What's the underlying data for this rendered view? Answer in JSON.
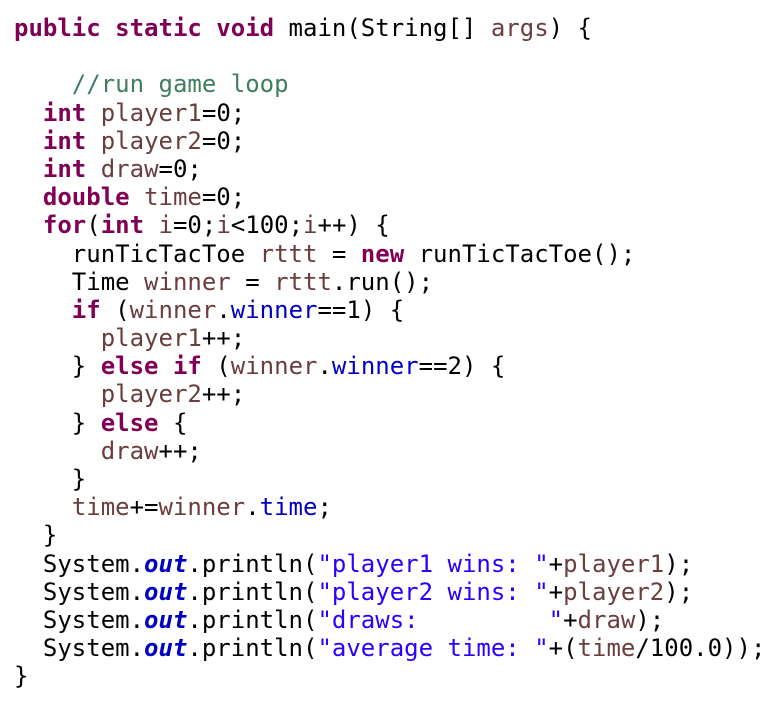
{
  "code_lines": [
    [
      {
        "t": "public static void",
        "c": "kw"
      },
      {
        "t": " main(String[] ",
        "c": "plain"
      },
      {
        "t": "args",
        "c": "var"
      },
      {
        "t": ") {",
        "c": "plain"
      }
    ],
    [],
    [
      {
        "t": "    ",
        "c": "plain"
      },
      {
        "t": "//run game loop",
        "c": "cmt"
      }
    ],
    [
      {
        "t": "  ",
        "c": "plain"
      },
      {
        "t": "int",
        "c": "kw"
      },
      {
        "t": " ",
        "c": "plain"
      },
      {
        "t": "player1",
        "c": "var"
      },
      {
        "t": "=0;",
        "c": "plain"
      }
    ],
    [
      {
        "t": "  ",
        "c": "plain"
      },
      {
        "t": "int",
        "c": "kw"
      },
      {
        "t": " ",
        "c": "plain"
      },
      {
        "t": "player2",
        "c": "var"
      },
      {
        "t": "=0;",
        "c": "plain"
      }
    ],
    [
      {
        "t": "  ",
        "c": "plain"
      },
      {
        "t": "int",
        "c": "kw"
      },
      {
        "t": " ",
        "c": "plain"
      },
      {
        "t": "draw",
        "c": "var"
      },
      {
        "t": "=0;",
        "c": "plain"
      }
    ],
    [
      {
        "t": "  ",
        "c": "plain"
      },
      {
        "t": "double",
        "c": "kw"
      },
      {
        "t": " ",
        "c": "plain"
      },
      {
        "t": "time",
        "c": "var"
      },
      {
        "t": "=0;",
        "c": "plain"
      }
    ],
    [
      {
        "t": "  ",
        "c": "plain"
      },
      {
        "t": "for",
        "c": "kw"
      },
      {
        "t": "(",
        "c": "plain"
      },
      {
        "t": "int",
        "c": "kw"
      },
      {
        "t": " ",
        "c": "plain"
      },
      {
        "t": "i",
        "c": "var"
      },
      {
        "t": "=0;",
        "c": "plain"
      },
      {
        "t": "i",
        "c": "var"
      },
      {
        "t": "<100;",
        "c": "plain"
      },
      {
        "t": "i",
        "c": "var"
      },
      {
        "t": "++) {",
        "c": "plain"
      }
    ],
    [
      {
        "t": "    runTicTacToe ",
        "c": "plain"
      },
      {
        "t": "rttt",
        "c": "var"
      },
      {
        "t": " = ",
        "c": "plain"
      },
      {
        "t": "new",
        "c": "kw"
      },
      {
        "t": " runTicTacToe();",
        "c": "plain"
      }
    ],
    [
      {
        "t": "    Time ",
        "c": "plain"
      },
      {
        "t": "winner",
        "c": "var"
      },
      {
        "t": " = ",
        "c": "plain"
      },
      {
        "t": "rttt",
        "c": "var"
      },
      {
        "t": ".run();",
        "c": "plain"
      }
    ],
    [
      {
        "t": "    ",
        "c": "plain"
      },
      {
        "t": "if",
        "c": "kw"
      },
      {
        "t": " (",
        "c": "plain"
      },
      {
        "t": "winner",
        "c": "var"
      },
      {
        "t": ".",
        "c": "plain"
      },
      {
        "t": "winner",
        "c": "field"
      },
      {
        "t": "==1) {",
        "c": "plain"
      }
    ],
    [
      {
        "t": "      ",
        "c": "plain"
      },
      {
        "t": "player1",
        "c": "var"
      },
      {
        "t": "++;",
        "c": "plain"
      }
    ],
    [
      {
        "t": "    } ",
        "c": "plain"
      },
      {
        "t": "else",
        "c": "kw"
      },
      {
        "t": " ",
        "c": "plain"
      },
      {
        "t": "if",
        "c": "kw"
      },
      {
        "t": " (",
        "c": "plain"
      },
      {
        "t": "winner",
        "c": "var"
      },
      {
        "t": ".",
        "c": "plain"
      },
      {
        "t": "winner",
        "c": "field"
      },
      {
        "t": "==2) {",
        "c": "plain"
      }
    ],
    [
      {
        "t": "      ",
        "c": "plain"
      },
      {
        "t": "player2",
        "c": "var"
      },
      {
        "t": "++;",
        "c": "plain"
      }
    ],
    [
      {
        "t": "    } ",
        "c": "plain"
      },
      {
        "t": "else",
        "c": "kw"
      },
      {
        "t": " {",
        "c": "plain"
      }
    ],
    [
      {
        "t": "      ",
        "c": "plain"
      },
      {
        "t": "draw",
        "c": "var"
      },
      {
        "t": "++;",
        "c": "plain"
      }
    ],
    [
      {
        "t": "    }",
        "c": "plain"
      }
    ],
    [
      {
        "t": "    ",
        "c": "plain"
      },
      {
        "t": "time",
        "c": "var"
      },
      {
        "t": "+=",
        "c": "plain"
      },
      {
        "t": "winner",
        "c": "var"
      },
      {
        "t": ".",
        "c": "plain"
      },
      {
        "t": "time",
        "c": "field"
      },
      {
        "t": ";",
        "c": "plain"
      }
    ],
    [
      {
        "t": "  }",
        "c": "plain"
      }
    ],
    [
      {
        "t": "  System.",
        "c": "plain"
      },
      {
        "t": "out",
        "c": "static-field"
      },
      {
        "t": ".println(",
        "c": "plain"
      },
      {
        "t": "\"player1 wins: \"",
        "c": "str"
      },
      {
        "t": "+",
        "c": "plain"
      },
      {
        "t": "player1",
        "c": "var"
      },
      {
        "t": ");",
        "c": "plain"
      }
    ],
    [
      {
        "t": "  System.",
        "c": "plain"
      },
      {
        "t": "out",
        "c": "static-field"
      },
      {
        "t": ".println(",
        "c": "plain"
      },
      {
        "t": "\"player2 wins: \"",
        "c": "str"
      },
      {
        "t": "+",
        "c": "plain"
      },
      {
        "t": "player2",
        "c": "var"
      },
      {
        "t": ");",
        "c": "plain"
      }
    ],
    [
      {
        "t": "  System.",
        "c": "plain"
      },
      {
        "t": "out",
        "c": "static-field"
      },
      {
        "t": ".println(",
        "c": "plain"
      },
      {
        "t": "\"draws:         \"",
        "c": "str"
      },
      {
        "t": "+",
        "c": "plain"
      },
      {
        "t": "draw",
        "c": "var"
      },
      {
        "t": ");",
        "c": "plain"
      }
    ],
    [
      {
        "t": "  System.",
        "c": "plain"
      },
      {
        "t": "out",
        "c": "static-field"
      },
      {
        "t": ".println(",
        "c": "plain"
      },
      {
        "t": "\"average time: \"",
        "c": "str"
      },
      {
        "t": "+(",
        "c": "plain"
      },
      {
        "t": "time",
        "c": "var"
      },
      {
        "t": "/100.0));",
        "c": "plain"
      }
    ],
    [
      {
        "t": "}",
        "c": "plain"
      }
    ]
  ],
  "colors": {
    "keyword": "#7f0055",
    "local_variable": "#6a3e3e",
    "field": "#0000c0",
    "string": "#2a00ff",
    "comment": "#3f7f5f",
    "default": "#000000",
    "background": "#ffffff"
  }
}
